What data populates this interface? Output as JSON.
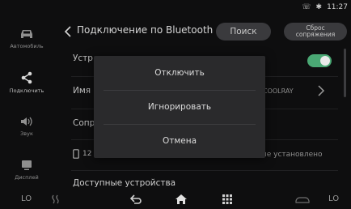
{
  "status": {
    "time": "11:27"
  },
  "sidebar": {
    "items": [
      {
        "label": "Автомобиль",
        "icon": "car-icon"
      },
      {
        "label": "Подключить",
        "icon": "share-icon",
        "active": true
      },
      {
        "label": "Звук",
        "icon": "speaker-icon"
      },
      {
        "label": "Дисплей",
        "icon": "display-icon"
      }
    ]
  },
  "header": {
    "title": "Подключение по Bluetooth",
    "search_label": "Поиск",
    "reset_label": "Сброс сопряжения"
  },
  "rows": {
    "device_label": "Устр",
    "name_label": "Имя",
    "name_value": "COOLRAY",
    "conn_label": "Сопр",
    "phone_label": "12",
    "phone_status": "ние установлено",
    "available_label": "Доступные устройства"
  },
  "dialog": {
    "options": [
      "Отключить",
      "Игнорировать",
      "Отмена"
    ]
  },
  "bottombar": {
    "left_temp": "LO",
    "right_temp": "LO"
  },
  "colors": {
    "accent": "#4aa874",
    "background": "#0e0e0f",
    "dialog": "#2a2a2c"
  }
}
